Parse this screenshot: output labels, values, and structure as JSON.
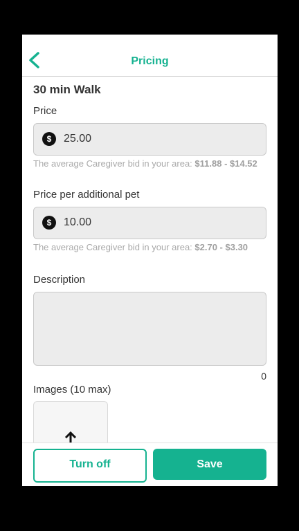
{
  "header": {
    "title": "Pricing"
  },
  "service": {
    "name": "30 min Walk"
  },
  "price": {
    "label": "Price",
    "currency_symbol": "$",
    "value": "25.00",
    "hint_text": "The average Caregiver bid in your area: ",
    "hint_range": "$11.88 - $14.52"
  },
  "additional_pet": {
    "label": "Price per additional pet",
    "currency_symbol": "$",
    "value": "10.00",
    "hint_text": "The average Caregiver bid in your area: ",
    "hint_range": "$2.70 - $3.30"
  },
  "description": {
    "label": "Description",
    "value": "",
    "counter": "0"
  },
  "images": {
    "label": "Images (10 max)",
    "upload_icon": "upload-arrow-icon"
  },
  "footer": {
    "turn_off_label": "Turn off",
    "save_label": "Save"
  },
  "colors": {
    "accent": "#15b290",
    "input_bg": "#ececec",
    "hint": "#a9a9a9"
  }
}
